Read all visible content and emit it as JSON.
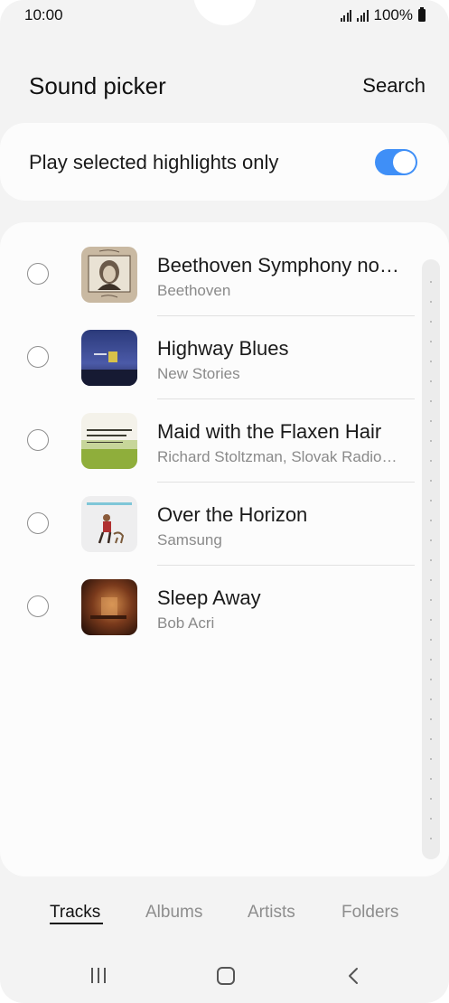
{
  "status_bar": {
    "time": "10:00",
    "battery": "100%"
  },
  "header": {
    "title": "Sound picker",
    "search_label": "Search"
  },
  "highlights_toggle": {
    "label": "Play selected highlights only",
    "enabled": true,
    "accent_color": "#3f8ff7"
  },
  "tracks": [
    {
      "title": "Beethoven Symphony no…",
      "subtitle": "Beethoven",
      "selected": false
    },
    {
      "title": "Highway Blues",
      "subtitle": "New Stories",
      "selected": false
    },
    {
      "title": "Maid with the Flaxen Hair",
      "subtitle": "Richard Stoltzman, Slovak Radio…",
      "selected": false
    },
    {
      "title": "Over the Horizon",
      "subtitle": "Samsung",
      "selected": false
    },
    {
      "title": "Sleep Away",
      "subtitle": "Bob Acri",
      "selected": false
    }
  ],
  "tabs": [
    {
      "label": "Tracks",
      "active": true
    },
    {
      "label": "Albums",
      "active": false
    },
    {
      "label": "Artists",
      "active": false
    },
    {
      "label": "Folders",
      "active": false
    }
  ],
  "nav": {
    "recents_icon": "recents-icon",
    "home_icon": "home-icon",
    "back_icon": "back-icon"
  }
}
